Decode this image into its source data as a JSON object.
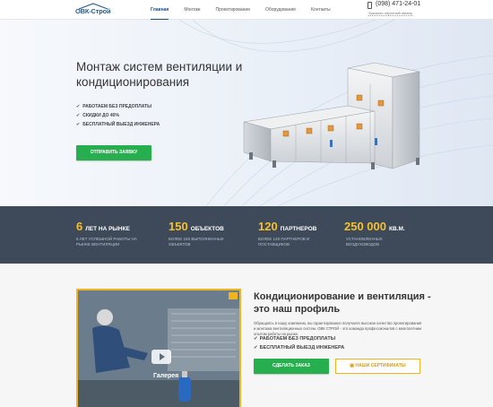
{
  "header": {
    "logo_text": "ОВК-Строй",
    "nav": [
      {
        "label": "Главная",
        "active": true
      },
      {
        "label": "Монтаж",
        "active": false
      },
      {
        "label": "Проектирование",
        "active": false
      },
      {
        "label": "Оборудование",
        "active": false
      },
      {
        "label": "Контакты",
        "active": false
      }
    ],
    "phone": "(098) 471-24-01",
    "callback_label": "Заказать обратный звонок"
  },
  "hero": {
    "title": "Монтаж систем вентиляции и кондиционирования",
    "features": [
      "РАБОТАЕМ БЕЗ ПРЕДОПЛАТЫ",
      "СКИДКИ ДО 40%",
      "БЕСПЛАТНЫЙ ВЫЕЗД ИНЖЕНЕРА"
    ],
    "button_label": "ОТПРАВИТЬ ЗАЯВКУ"
  },
  "stats": [
    {
      "number": "6",
      "unit": "ЛЕТ НА РЫНКЕ",
      "desc_1": "6 ЛЕТ УСПЕШНОЙ РАБОТЫ НА",
      "desc_2": "РЫНКЕ ВЕНТИЛЯЦИИ"
    },
    {
      "number": "150",
      "unit": "ОБЪЕКТОВ",
      "desc_1": "БОЛЕЕ 150 ВЫПОЛНЕННЫХ",
      "desc_2": "ОБЪЕКТОВ"
    },
    {
      "number": "120",
      "unit": "ПАРТНЕРОВ",
      "desc_1": "БОЛЕЕ 120 ПАРТНЕРОВ И",
      "desc_2": "ПОСТАВЩИКОВ"
    },
    {
      "number": "250 000",
      "unit": "КВ.М.",
      "desc_1": "УСТАНОВЛЕННЫХ",
      "desc_2": "ВОЗДУХОВОДОВ"
    }
  ],
  "about": {
    "gallery_label": "Галерея",
    "title": "Кондиционирование и вентиляция - это наш профиль",
    "text": "Обращаясь в нашу компанию, вы гарантированно получаете высокое качество проектирования и монтажа вентиляционных систем. ОВК СТРОЙ - это команда профессионалов с многолетним опытом работы на рынке.",
    "features": [
      "РАБОТАЕМ БЕЗ ПРЕДОПЛАТЫ",
      "БЕСПЛАТНЫЙ ВЫЕЗД ИНЖЕНЕРА"
    ],
    "order_label": "СДЕЛАТЬ ЗАКАЗ",
    "cert_label": "НАШИ СЕРТИФИКАТЫ"
  },
  "colors": {
    "accent_green": "#27ae4f",
    "accent_yellow": "#f5c02e",
    "dark_band": "#3e4a5a",
    "brand_blue": "#2a5d8e"
  }
}
